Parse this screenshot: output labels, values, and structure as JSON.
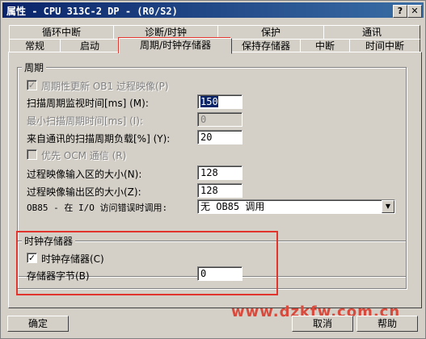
{
  "window": {
    "title": "属性 - CPU 313C-2 DP - (R0/S2)"
  },
  "tabs_row1": [
    "循环中断",
    "诊断/时钟",
    "保护",
    "通讯"
  ],
  "tabs_row2": [
    "常规",
    "启动",
    "周期/时钟存储器",
    "保持存储器",
    "中断",
    "时间中断"
  ],
  "cycle": {
    "group_title": "周期",
    "periodic_update_label": "周期性更新 OB1 过程映像(P)",
    "scan_monitor_label": "扫描周期监视时间[ms] (M):",
    "scan_monitor_value": "150",
    "min_scan_label": "最小扫描周期时间[ms] (I):",
    "min_scan_value": "0",
    "comm_load_label": "来自通讯的扫描周期负载[%] (Y):",
    "comm_load_value": "20",
    "ocm_label": "优先 OCM 通信 (R)",
    "input_image_label": "过程映像输入区的大小(N):",
    "input_image_value": "128",
    "output_image_label": "过程映像输出区的大小(Z):",
    "output_image_value": "128",
    "ob85_label": "OB85 - 在 I/O 访问错误时调用:",
    "ob85_value": "无 OB85 调用"
  },
  "clock": {
    "group_title": "时钟存储器",
    "clock_memory_label": "时钟存储器(C)",
    "memory_byte_label": "存储器字节(B)",
    "memory_byte_value": "0"
  },
  "buttons": {
    "ok": "确定",
    "cancel": "取消",
    "help": "帮助"
  },
  "watermark": "www.dzkfw.com.cn",
  "colors": {
    "highlight_box": "#e0342c",
    "title_bar": "#0a246a"
  }
}
